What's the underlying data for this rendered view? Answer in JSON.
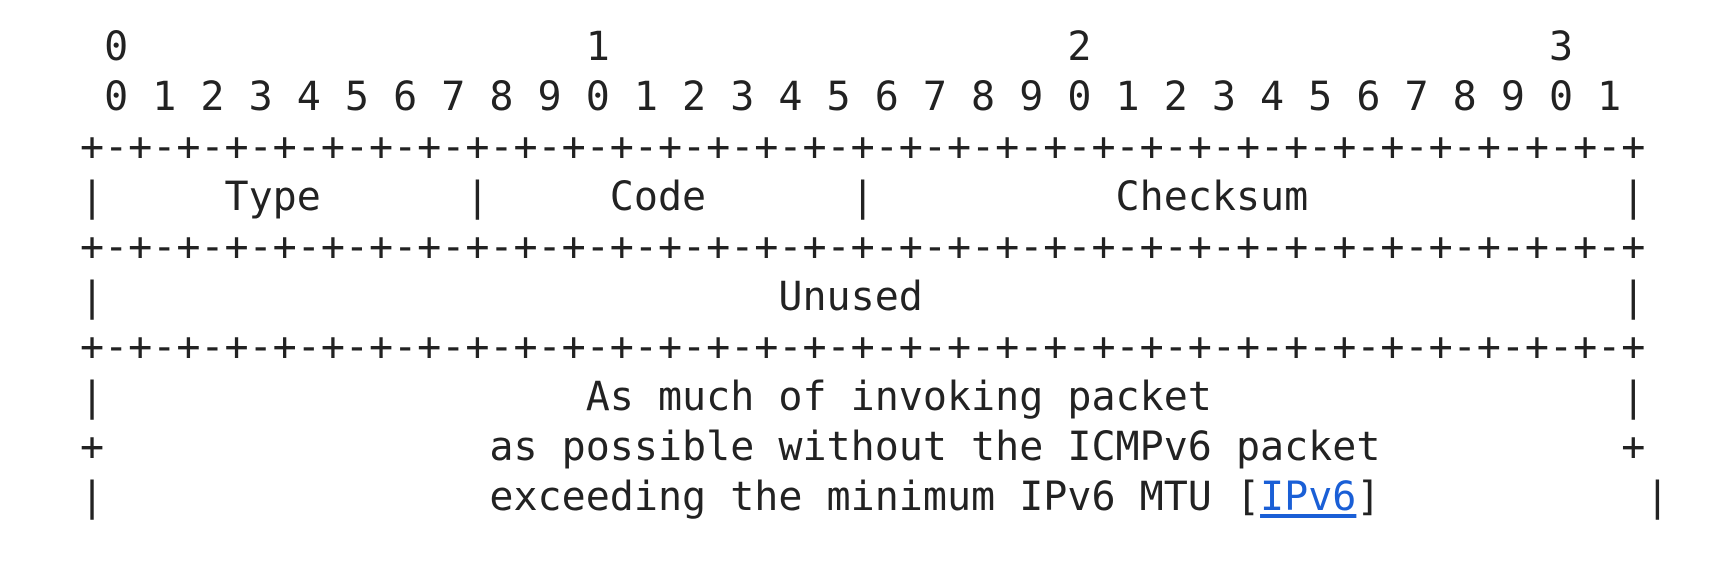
{
  "diagram": {
    "bit_header_tens": " 0                   1                   2                   3",
    "bit_header_units": " 0 1 2 3 4 5 6 7 8 9 0 1 2 3 4 5 6 7 8 9 0 1 2 3 4 5 6 7 8 9 0 1",
    "separator": "+-+-+-+-+-+-+-+-+-+-+-+-+-+-+-+-+-+-+-+-+-+-+-+-+-+-+-+-+-+-+-+-+",
    "fields_row": "|     Type      |     Code      |          Checksum             |",
    "unused_row": "|                            Unused                             |",
    "body_line_1": "|                    As much of invoking packet                 |",
    "body_line_2": "+                as possible without the ICMPv6 packet          +",
    "body_line_3_prefix": "|                exceeding the minimum IPv6 MTU [",
    "body_line_3_link": "IPv6",
    "body_line_3_suffix": "]           |"
  },
  "colors": {
    "text": "#222222",
    "link": "#1a5fd6",
    "background": "#ffffff"
  }
}
